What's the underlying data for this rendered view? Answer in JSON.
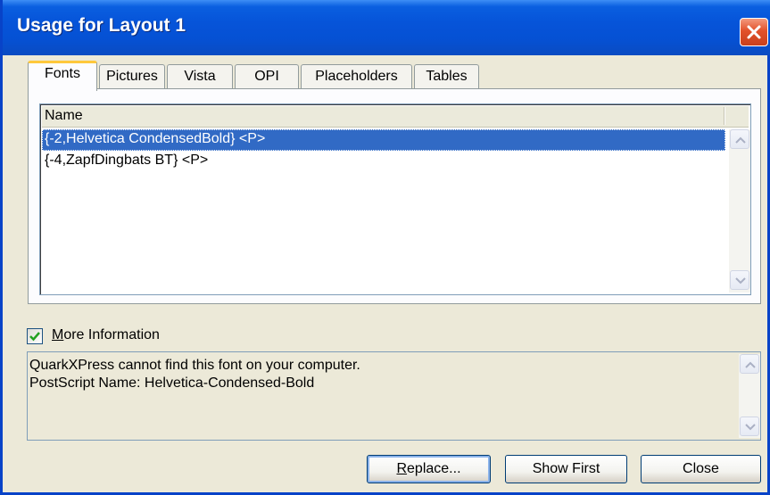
{
  "window": {
    "title": "Usage for Layout 1"
  },
  "tabs": [
    {
      "label": "Fonts",
      "active": true
    },
    {
      "label": "Pictures",
      "active": false
    },
    {
      "label": "Vista",
      "active": false
    },
    {
      "label": "OPI",
      "active": false
    },
    {
      "label": "Placeholders",
      "active": false
    },
    {
      "label": "Tables",
      "active": false
    }
  ],
  "list": {
    "column_header": "Name",
    "rows": [
      {
        "name": "{-2,Helvetica CondensedBold} <P>",
        "selected": true
      },
      {
        "name": "{-4,ZapfDingbats BT} <P>",
        "selected": false
      }
    ]
  },
  "more_info": {
    "checked": true,
    "label_first": "M",
    "label_rest": "ore Information",
    "lines": [
      "QuarkXPress cannot find this font on your computer.",
      "PostScript Name:  Helvetica-Condensed-Bold"
    ]
  },
  "buttons": {
    "replace_first": "R",
    "replace_rest": "eplace...",
    "show_first": "Show First",
    "close": "Close"
  },
  "icons": {
    "close": "close-icon",
    "scroll_up": "chevron-up-icon",
    "scroll_down": "chevron-down-icon",
    "check": "checkmark-icon"
  },
  "colors": {
    "titlebar": "#0654d9",
    "selection": "#316ac5",
    "active_tab_accent": "#ffc83c",
    "close_button": "#e2512a"
  }
}
